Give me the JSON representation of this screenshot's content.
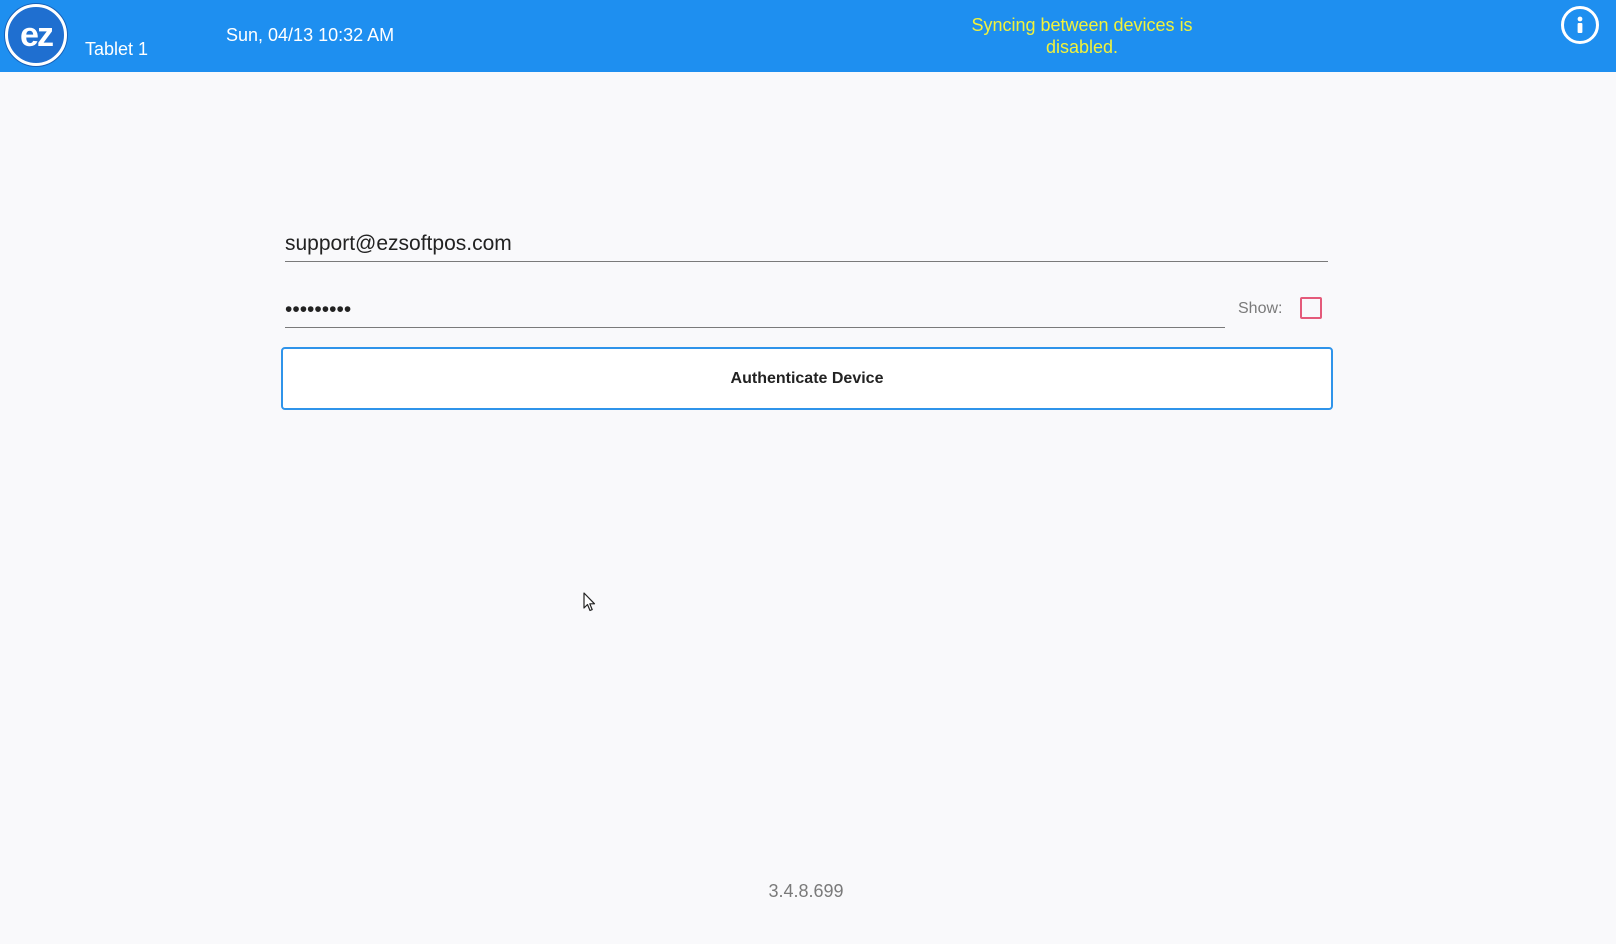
{
  "header": {
    "logo_text": "ez",
    "device_name": "Tablet 1",
    "datetime": "Sun, 04/13 10:32 AM",
    "sync_status": "Syncing between devices is disabled.",
    "info_icon": "info-icon"
  },
  "form": {
    "email_value": "support@ezsoftpos.com",
    "password_value": "•••••••••",
    "show_label": "Show:",
    "show_checked": false,
    "auth_button_label": "Authenticate Device"
  },
  "footer": {
    "version": "3.4.8.699"
  },
  "colors": {
    "header_bg": "#1e8ff0",
    "sync_text": "#f2f23a",
    "button_border": "#2f94ea",
    "checkbox_border": "#e45a7a",
    "page_bg": "#f9f9fb"
  }
}
